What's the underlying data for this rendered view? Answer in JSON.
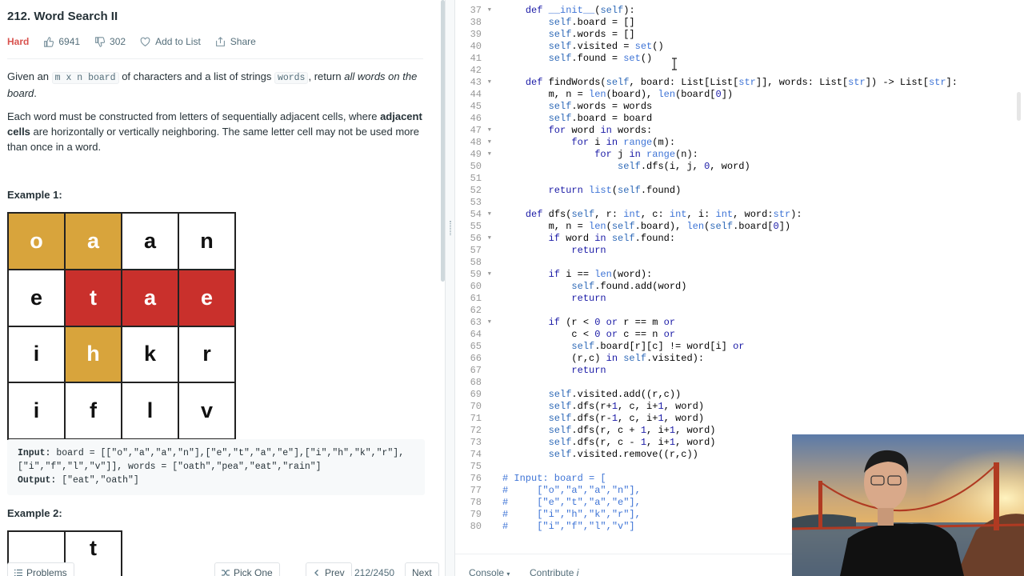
{
  "problem": {
    "title": "212. Word Search II",
    "difficulty": "Hard",
    "likes": "6941",
    "dislikes": "302",
    "add_to_list": "Add to List",
    "share": "Share"
  },
  "description": {
    "p1_a": "Given an ",
    "p1_code1": "m x n board",
    "p1_b": " of characters and a list of strings ",
    "p1_code2": "words",
    "p1_c": ", return ",
    "p1_em": "all words on the board",
    "p1_d": ".",
    "p2_a": "Each word must be constructed from letters of sequentially adjacent cells, where ",
    "p2_bold": "adjacent cells",
    "p2_b": " are horizontally or vertically neighboring. The same letter cell may not be used more than once in a word."
  },
  "example1": {
    "title": "Example 1:",
    "board": [
      [
        {
          "ch": "o",
          "hl": "gold"
        },
        {
          "ch": "a",
          "hl": "gold"
        },
        {
          "ch": "a",
          "hl": ""
        },
        {
          "ch": "n",
          "hl": ""
        }
      ],
      [
        {
          "ch": "e",
          "hl": ""
        },
        {
          "ch": "t",
          "hl": "red"
        },
        {
          "ch": "a",
          "hl": "red"
        },
        {
          "ch": "e",
          "hl": "red"
        }
      ],
      [
        {
          "ch": "i",
          "hl": ""
        },
        {
          "ch": "h",
          "hl": "gold"
        },
        {
          "ch": "k",
          "hl": ""
        },
        {
          "ch": "r",
          "hl": ""
        }
      ],
      [
        {
          "ch": "i",
          "hl": ""
        },
        {
          "ch": "f",
          "hl": ""
        },
        {
          "ch": "l",
          "hl": ""
        },
        {
          "ch": "v",
          "hl": ""
        }
      ]
    ],
    "input_label": "Input:",
    "input_line1": " board = [[\"o\",\"a\",\"a\",\"n\"],[\"e\",\"t\",\"a\",\"e\"],[\"i\",\"h\",\"k\",\"r\"],",
    "input_line2": "[\"i\",\"f\",\"l\",\"v\"]], words = [\"oath\",\"pea\",\"eat\",\"rain\"]",
    "output_label": "Output:",
    "output_value": " [\"eat\",\"oath\"]"
  },
  "example2": {
    "title": "Example 2:",
    "visible_cells": [
      "",
      "t"
    ]
  },
  "bottom_bar": {
    "problems": "Problems",
    "pick_one": "Pick One",
    "prev": "Prev",
    "page": "212/2450",
    "next": "Next",
    "console": "Console",
    "contribute": "Contribute"
  },
  "colors": {
    "highlight_gold": "#d8a43c",
    "highlight_red": "#c9302c",
    "difficulty_hard": "#d9534f",
    "keyword_blue": "#1a1aa6",
    "builtin_blue": "#3e74d6"
  },
  "code": {
    "lines": [
      {
        "n": "37",
        "fold": true,
        "html": "    <span class=\"kw\">def</span> <span class=\"bi\">__init__</span>(<span class=\"self\">self</span>):"
      },
      {
        "n": "38",
        "fold": false,
        "html": "        <span class=\"self\">self</span>.board = []"
      },
      {
        "n": "39",
        "fold": false,
        "html": "        <span class=\"self\">self</span>.words = []"
      },
      {
        "n": "40",
        "fold": false,
        "html": "        <span class=\"self\">self</span>.visited = <span class=\"bi\">set</span>()"
      },
      {
        "n": "41",
        "fold": false,
        "html": "        <span class=\"self\">self</span>.found = <span class=\"bi\">set</span>()"
      },
      {
        "n": "42",
        "fold": false,
        "html": ""
      },
      {
        "n": "43",
        "fold": true,
        "html": "    <span class=\"kw\">def</span> findWords(<span class=\"self\">self</span>, board: List[List[<span class=\"bi\">str</span>]], words: List[<span class=\"bi\">str</span>]) -> List[<span class=\"bi\">str</span>]:"
      },
      {
        "n": "44",
        "fold": false,
        "html": "        m, n = <span class=\"bi\">len</span>(board), <span class=\"bi\">len</span>(board[<span class=\"num\">0</span>])"
      },
      {
        "n": "45",
        "fold": false,
        "html": "        <span class=\"self\">self</span>.words = words"
      },
      {
        "n": "46",
        "fold": false,
        "html": "        <span class=\"self\">self</span>.board = board"
      },
      {
        "n": "47",
        "fold": true,
        "html": "        <span class=\"kw\">for</span> word <span class=\"kw\">in</span> words:"
      },
      {
        "n": "48",
        "fold": true,
        "html": "            <span class=\"kw\">for</span> i <span class=\"kw\">in</span> <span class=\"bi\">range</span>(m):"
      },
      {
        "n": "49",
        "fold": true,
        "html": "                <span class=\"kw\">for</span> j <span class=\"kw\">in</span> <span class=\"bi\">range</span>(n):"
      },
      {
        "n": "50",
        "fold": false,
        "html": "                    <span class=\"self\">self</span>.dfs(i, j, <span class=\"num\">0</span>, word)"
      },
      {
        "n": "51",
        "fold": false,
        "html": ""
      },
      {
        "n": "52",
        "fold": false,
        "html": "        <span class=\"kw\">return</span> <span class=\"bi\">list</span>(<span class=\"self\">self</span>.found)"
      },
      {
        "n": "53",
        "fold": false,
        "html": ""
      },
      {
        "n": "54",
        "fold": true,
        "html": "    <span class=\"kw\">def</span> dfs(<span class=\"self\">self</span>, r: <span class=\"bi\">int</span>, c: <span class=\"bi\">int</span>, i: <span class=\"bi\">int</span>, word:<span class=\"bi\">str</span>):"
      },
      {
        "n": "55",
        "fold": false,
        "html": "        m, n = <span class=\"bi\">len</span>(<span class=\"self\">self</span>.board), <span class=\"bi\">len</span>(<span class=\"self\">self</span>.board[<span class=\"num\">0</span>])"
      },
      {
        "n": "56",
        "fold": true,
        "html": "        <span class=\"kw\">if</span> word <span class=\"kw\">in</span> <span class=\"self\">self</span>.found:"
      },
      {
        "n": "57",
        "fold": false,
        "html": "            <span class=\"kw\">return</span>"
      },
      {
        "n": "58",
        "fold": false,
        "html": ""
      },
      {
        "n": "59",
        "fold": true,
        "html": "        <span class=\"kw\">if</span> i == <span class=\"bi\">len</span>(word):"
      },
      {
        "n": "60",
        "fold": false,
        "html": "            <span class=\"self\">self</span>.found.add(word)"
      },
      {
        "n": "61",
        "fold": false,
        "html": "            <span class=\"kw\">return</span>"
      },
      {
        "n": "62",
        "fold": false,
        "html": ""
      },
      {
        "n": "63",
        "fold": true,
        "html": "        <span class=\"kw\">if</span> (r &lt; <span class=\"num\">0</span> <span class=\"kw\">or</span> r == m <span class=\"kw\">or</span>"
      },
      {
        "n": "64",
        "fold": false,
        "html": "            c &lt; <span class=\"num\">0</span> <span class=\"kw\">or</span> c == n <span class=\"kw\">or</span>"
      },
      {
        "n": "65",
        "fold": false,
        "html": "            <span class=\"self\">self</span>.board[r][c] != word[i] <span class=\"kw\">or</span>"
      },
      {
        "n": "66",
        "fold": false,
        "html": "            (r,c) <span class=\"kw\">in</span> <span class=\"self\">self</span>.visited):"
      },
      {
        "n": "67",
        "fold": false,
        "html": "            <span class=\"kw\">return</span>"
      },
      {
        "n": "68",
        "fold": false,
        "html": ""
      },
      {
        "n": "69",
        "fold": false,
        "html": "        <span class=\"self\">self</span>.visited.add((r,c))"
      },
      {
        "n": "70",
        "fold": false,
        "html": "        <span class=\"self\">self</span>.dfs(r+<span class=\"num\">1</span>, c, i+<span class=\"num\">1</span>, word)"
      },
      {
        "n": "71",
        "fold": false,
        "html": "        <span class=\"self\">self</span>.dfs(r-<span class=\"num\">1</span>, c, i+<span class=\"num\">1</span>, word)"
      },
      {
        "n": "72",
        "fold": false,
        "html": "        <span class=\"self\">self</span>.dfs(r, c + <span class=\"num\">1</span>, i+<span class=\"num\">1</span>, word)"
      },
      {
        "n": "73",
        "fold": false,
        "html": "        <span class=\"self\">self</span>.dfs(r, c - <span class=\"num\">1</span>, i+<span class=\"num\">1</span>, word)"
      },
      {
        "n": "74",
        "fold": false,
        "html": "        <span class=\"self\">self</span>.visited.remove((r,c))"
      },
      {
        "n": "75",
        "fold": false,
        "html": ""
      },
      {
        "n": "76",
        "fold": false,
        "html": "<span class=\"cmt\"># Input: board = [</span>"
      },
      {
        "n": "77",
        "fold": false,
        "html": "<span class=\"cmt\">#     [\"o\",\"a\",\"a\",\"n\"],</span>"
      },
      {
        "n": "78",
        "fold": false,
        "html": "<span class=\"cmt\">#     [\"e\",\"t\",\"a\",\"e\"],</span>"
      },
      {
        "n": "79",
        "fold": false,
        "html": "<span class=\"cmt\">#     [\"i\",\"h\",\"k\",\"r\"],</span>"
      },
      {
        "n": "80",
        "fold": false,
        "html": "<span class=\"cmt\">#     [\"i\",\"f\",\"l\",\"v\"]</span>"
      }
    ]
  }
}
